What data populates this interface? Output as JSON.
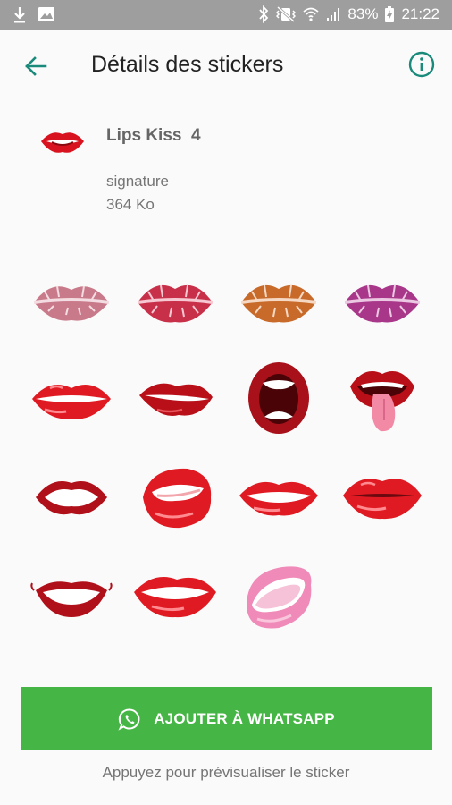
{
  "status_bar": {
    "battery": "83%",
    "time": "21:22"
  },
  "header": {
    "title": "Détails des stickers",
    "back_icon": "arrow-left-icon",
    "info_icon": "info-icon",
    "accent_color": "#1a8a7a"
  },
  "pack": {
    "name": "Lips Kiss  4",
    "author": "signature",
    "size": "364 Ko"
  },
  "stickers": [
    "lips-print-pale-pink",
    "lips-print-pink",
    "lips-print-orange",
    "lips-print-purple",
    "lips-glossy-red",
    "lips-dark-red-pout",
    "mouth-open-dark-red",
    "mouth-tongue-out",
    "lips-outline-dark-red",
    "lips-biting-red",
    "lips-smile-red",
    "lips-pout-red",
    "lips-grin-dark-red",
    "lips-smile-red-wide",
    "lips-pink-open"
  ],
  "action": {
    "add_label": "AJOUTER À WHATSAPP",
    "add_icon": "whatsapp-icon",
    "button_color": "#45b545",
    "hint": "Appuyez pour prévisualiser le sticker"
  }
}
